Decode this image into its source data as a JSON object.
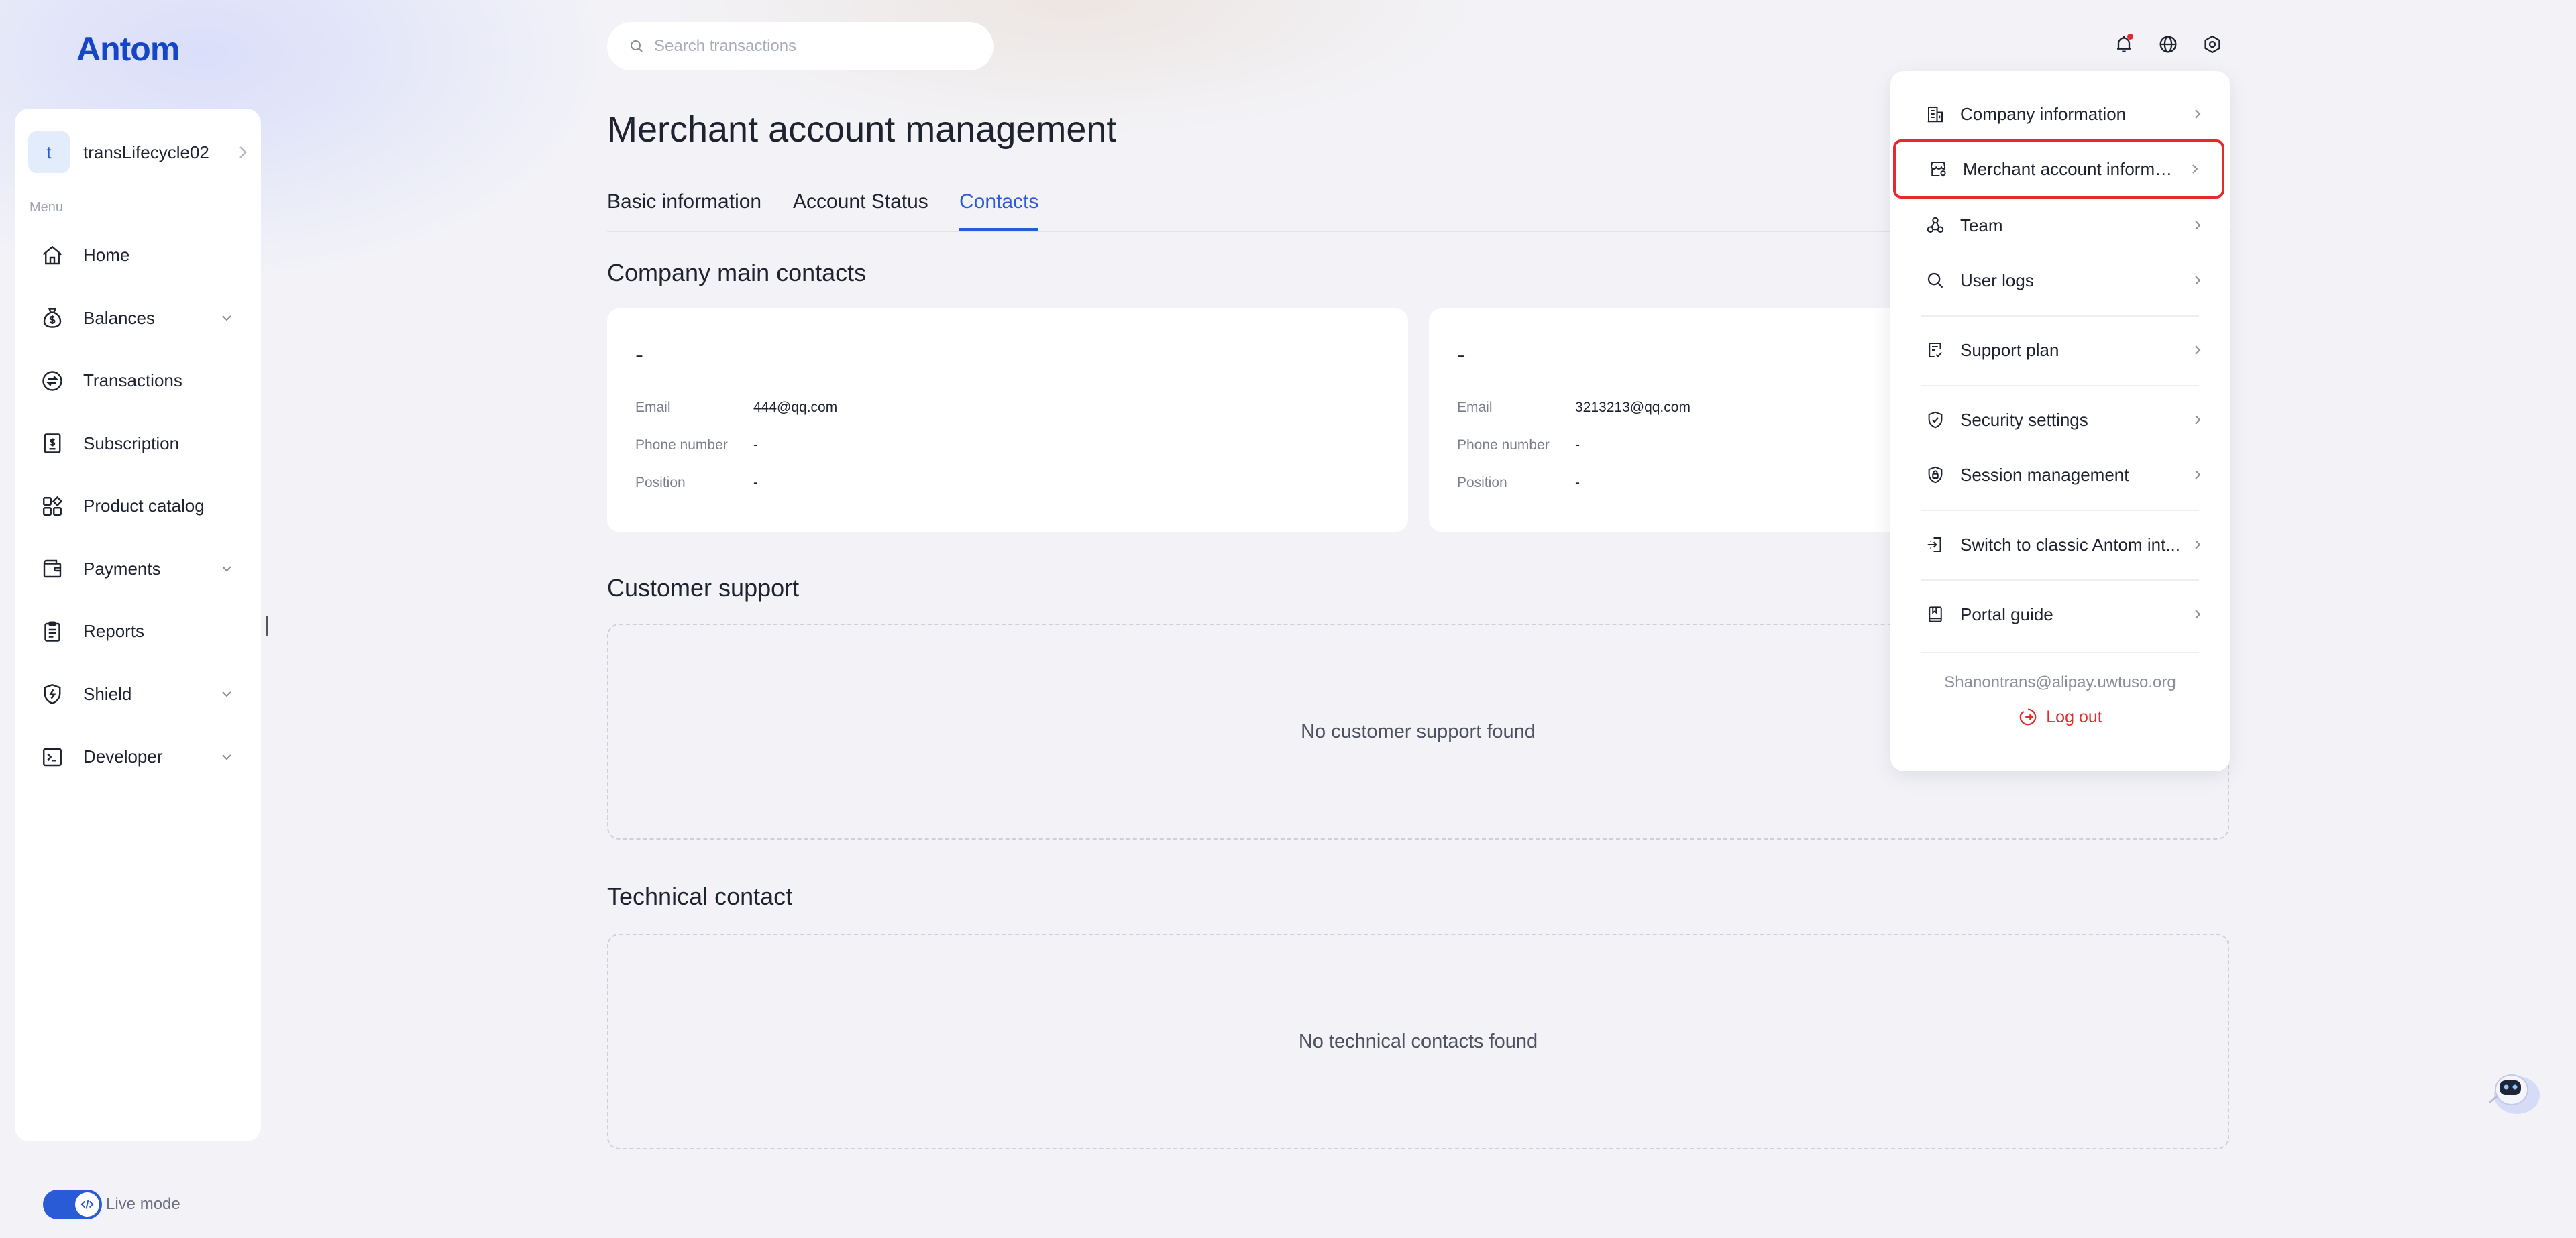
{
  "brand": {
    "logo_text": "Antom",
    "accent": "#2a5bd7",
    "danger": "#e42a2a"
  },
  "account": {
    "avatar_letter": "t",
    "name": "transLifecycle02"
  },
  "sidebar": {
    "menu_label": "Menu",
    "items": [
      {
        "label": "Home",
        "icon": "home-icon",
        "expandable": false
      },
      {
        "label": "Balances",
        "icon": "money-bag-icon",
        "expandable": true
      },
      {
        "label": "Transactions",
        "icon": "exchange-icon",
        "expandable": false
      },
      {
        "label": "Subscription",
        "icon": "receipt-icon",
        "expandable": false
      },
      {
        "label": "Product catalog",
        "icon": "grid-icon",
        "expandable": false
      },
      {
        "label": "Payments",
        "icon": "wallet-icon",
        "expandable": true
      },
      {
        "label": "Reports",
        "icon": "clipboard-icon",
        "expandable": false
      },
      {
        "label": "Shield",
        "icon": "shield-icon",
        "expandable": true
      },
      {
        "label": "Developer",
        "icon": "terminal-icon",
        "expandable": true
      }
    ],
    "live_mode_label": "Live mode",
    "live_mode_on": true
  },
  "search": {
    "placeholder": "Search transactions"
  },
  "page": {
    "title": "Merchant account management",
    "tabs": [
      {
        "label": "Basic information",
        "active": false
      },
      {
        "label": "Account Status",
        "active": false
      },
      {
        "label": "Contacts",
        "active": true
      }
    ]
  },
  "company_contacts": {
    "heading": "Company main contacts",
    "cards": [
      {
        "name": "-",
        "email_label": "Email",
        "email": "444@qq.com",
        "phone_label": "Phone number",
        "phone": "-",
        "position_label": "Position",
        "position": "-"
      },
      {
        "name": "-",
        "email_label": "Email",
        "email": "3213213@qq.com",
        "phone_label": "Phone number",
        "phone": "-",
        "position_label": "Position",
        "position": "-"
      }
    ]
  },
  "customer_support": {
    "heading": "Customer support",
    "empty_text": "No customer support found"
  },
  "technical_contact": {
    "heading": "Technical contact",
    "empty_text": "No technical contacts found"
  },
  "settings_menu": {
    "items": [
      {
        "label": "Company information",
        "icon": "building-icon"
      },
      {
        "label": "Merchant account informa...",
        "icon": "store-icon",
        "highlighted": true
      },
      {
        "label": "Team",
        "icon": "team-icon"
      },
      {
        "label": "User logs",
        "icon": "search-icon"
      },
      {
        "label": "Support plan",
        "icon": "document-icon"
      },
      {
        "label": "Security settings",
        "icon": "shield-check-icon"
      },
      {
        "label": "Session management",
        "icon": "lock-shield-icon"
      },
      {
        "label": "Switch to classic Antom int...",
        "icon": "switch-icon"
      },
      {
        "label": "Portal guide",
        "icon": "book-icon"
      }
    ],
    "user_email": "Shanontrans@alipay.uwtuso.org",
    "logout_label": "Log out"
  }
}
